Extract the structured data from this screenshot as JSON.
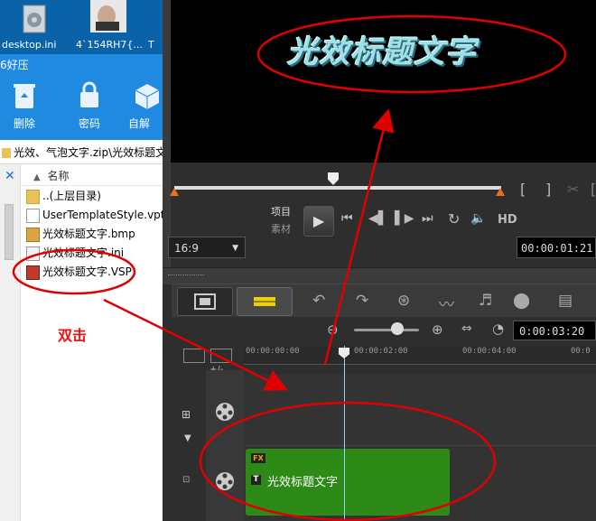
{
  "desktop": {
    "icons": [
      {
        "label": "desktop.ini",
        "icon": "gear-file-icon"
      },
      {
        "label": "4`154RH7{...",
        "icon": "image-thumbnail"
      },
      {
        "label": "T",
        "icon": "file-icon"
      }
    ]
  },
  "explorer": {
    "ribbon_title": "6好压",
    "buttons": [
      {
        "label": "删除",
        "icon": "recycle-icon"
      },
      {
        "label": "密码",
        "icon": "lock-icon"
      },
      {
        "label": "自解",
        "icon": "package-icon"
      }
    ],
    "address": "光效、气泡文字.zip\\光效标题文",
    "column_header": "名称",
    "files": [
      {
        "name": "..(上层目录)",
        "icon": "folder-icon"
      },
      {
        "name": "UserTemplateStyle.vpt",
        "icon": "file-icon"
      },
      {
        "name": "光效标题文字.bmp",
        "icon": "bmp-file-icon"
      },
      {
        "name": "光效标题文字.ini",
        "icon": "ini-file-icon"
      },
      {
        "name": "光效标题文字.VSP",
        "icon": "vsp-file-icon"
      }
    ],
    "annotation": "双击"
  },
  "preview": {
    "title_text": "光效标题文字",
    "labels": {
      "project": "项目",
      "clip": "素材"
    },
    "hd_label": "HD",
    "aspect": "16:9",
    "timecode": "00:00:01:21"
  },
  "timeline": {
    "zoom_timecode": "0:00:03:20",
    "ruler": [
      "00:00:00:00",
      "00:00:02:00",
      "00:00:04:00",
      "00:0"
    ],
    "clip_title": "光效标题文字",
    "fx": "FX",
    "t": "T",
    "add_remove": "+/-"
  },
  "colors": {
    "annotation": "#e00000",
    "clip": "#2d8a16",
    "marker": "#e7701c"
  }
}
